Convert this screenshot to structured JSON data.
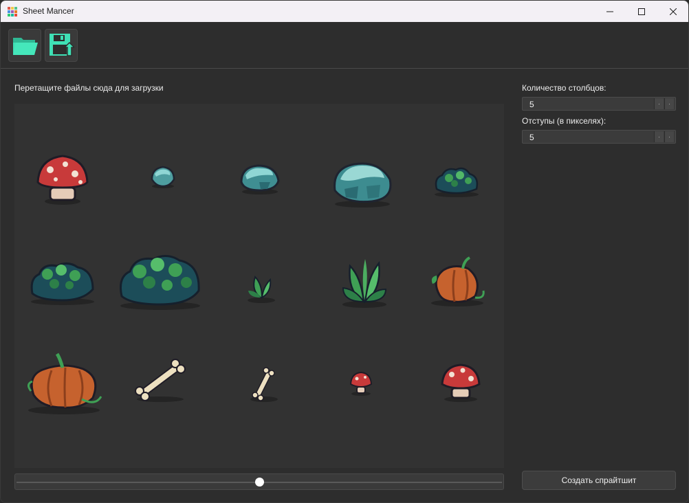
{
  "window": {
    "title": "Sheet Mancer",
    "minimize_glyph": "—",
    "maximize_glyph": "☐",
    "close_glyph": "✕"
  },
  "toolbar": {
    "open_icon": "folder-open-icon",
    "save_icon": "save-export-icon",
    "accent_color": "#3fd9b0"
  },
  "drop_area": {
    "label": "Перетащите файлы сюда для загрузки"
  },
  "sprites": [
    {
      "name": "mushroom-large"
    },
    {
      "name": "stone-small"
    },
    {
      "name": "stone-medium"
    },
    {
      "name": "stone-large"
    },
    {
      "name": "bush-small"
    },
    {
      "name": "bush-medium"
    },
    {
      "name": "bush-large"
    },
    {
      "name": "sprout-small"
    },
    {
      "name": "plant-leafy"
    },
    {
      "name": "pumpkin-vine"
    },
    {
      "name": "pumpkin-large"
    },
    {
      "name": "bone-large"
    },
    {
      "name": "bone-small"
    },
    {
      "name": "mushroom-tiny"
    },
    {
      "name": "mushroom-medium"
    }
  ],
  "zoom_slider": {
    "value": 0.5
  },
  "settings": {
    "columns_label": "Количество столбцов:",
    "columns_value": "5",
    "padding_label": "Отступы (в пикселях):",
    "padding_value": "5",
    "spin_up_glyph": "·",
    "spin_down_glyph": "·"
  },
  "actions": {
    "create_label": "Создать спрайтшит"
  }
}
